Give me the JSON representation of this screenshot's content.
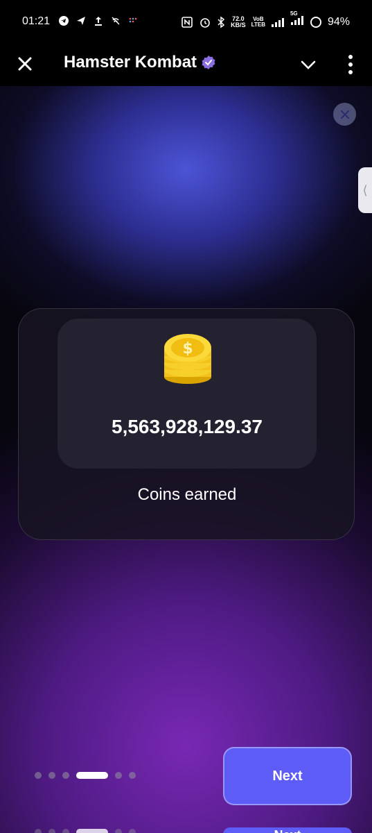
{
  "status_bar": {
    "time": "01:21",
    "speed_value": "72.0",
    "speed_unit": "KB/S",
    "volte_top": "VoB",
    "volte_bottom": "LTEB",
    "network": "5G",
    "battery": "94%"
  },
  "header": {
    "title": "Hamster Kombat",
    "accent_color": "#8b6fe0"
  },
  "card": {
    "amount": "5,563,928,129.37",
    "caption": "Coins earned"
  },
  "pager": {
    "total": 6,
    "active_index": 3
  },
  "actions": {
    "next_label": "Next",
    "next_color": "#5d5cf6"
  },
  "ghost": {
    "next_label": "Next"
  }
}
